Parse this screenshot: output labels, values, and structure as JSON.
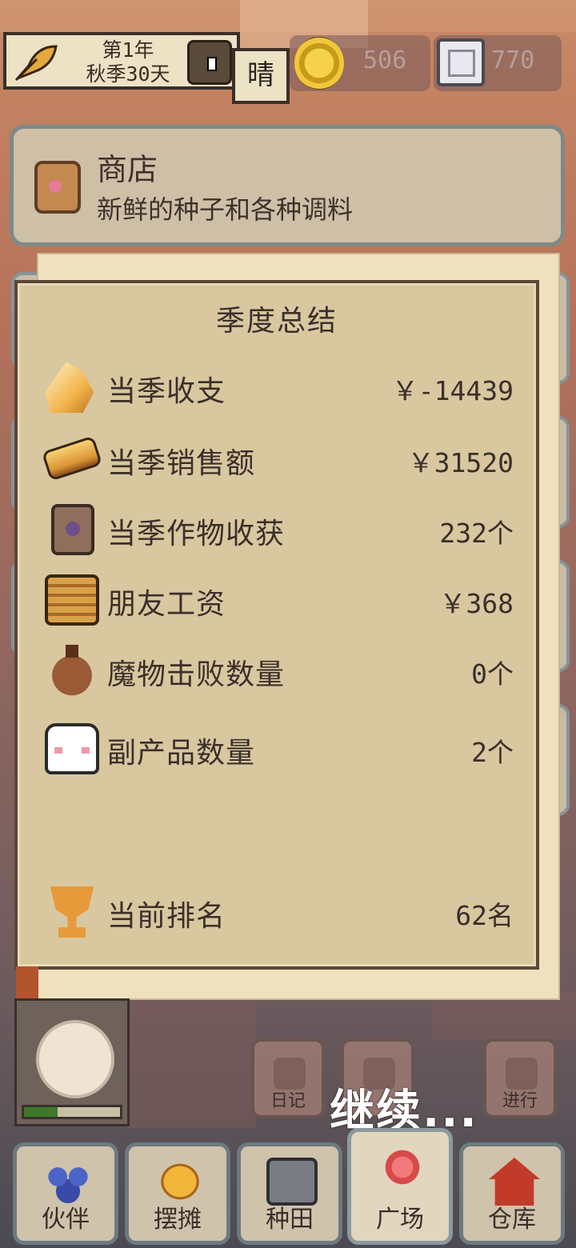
{
  "hud": {
    "date_line1": "第1年",
    "date_line2": "秋季30天",
    "weather": "晴",
    "gold_coins": "506",
    "silver_coins": "770"
  },
  "shop": {
    "title": "商店",
    "subtitle": "新鲜的种子和各种调料"
  },
  "summary": {
    "title": "季度总结",
    "rows": [
      {
        "label": "当季收支",
        "value": "￥-14439",
        "icon": "crystal-icon"
      },
      {
        "label": "当季销售额",
        "value": "￥31520",
        "icon": "bread-icon"
      },
      {
        "label": "当季作物收获",
        "value": "232个",
        "icon": "seed-bag-icon"
      },
      {
        "label": "朋友工资",
        "value": "￥368",
        "icon": "basket-icon"
      },
      {
        "label": "魔物击败数量",
        "value": "0个",
        "icon": "pouch-icon"
      },
      {
        "label": "副产品数量",
        "value": "2个",
        "icon": "ghost-icon"
      }
    ],
    "rank_label": "当前排名",
    "rank_value": "62名"
  },
  "actions": {
    "diary": "日记",
    "proceed": "进行",
    "continue": "继续..."
  },
  "portrait": {
    "stamina_fraction": 0.35
  },
  "nav": [
    {
      "label": "伙伴",
      "icon": "people-icon"
    },
    {
      "label": "摆摊",
      "icon": "stall-icon"
    },
    {
      "label": "种田",
      "icon": "watering-can-icon"
    },
    {
      "label": "广场",
      "icon": "flower-icon"
    },
    {
      "label": "仓库",
      "icon": "house-icon"
    }
  ]
}
